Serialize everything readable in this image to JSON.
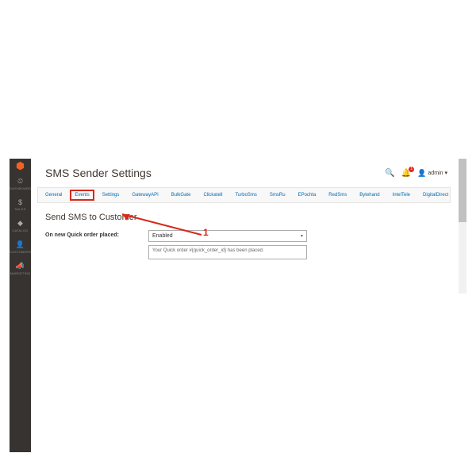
{
  "colors": {
    "accent": "#f26322",
    "link": "#006bb4",
    "annot": "#d62a1a",
    "sidebar": "#373330"
  },
  "sidebar": {
    "items": [
      {
        "icon": "⏲",
        "label": "DASHBOARD"
      },
      {
        "icon": "$",
        "label": "SALES"
      },
      {
        "icon": "◆",
        "label": "CATALOG"
      },
      {
        "icon": "👤",
        "label": "CUSTOMERS"
      },
      {
        "icon": "📣",
        "label": "MARKETING"
      }
    ]
  },
  "header": {
    "title": "SMS Sender Settings",
    "notif_count": "1",
    "user": "admin"
  },
  "tabs": [
    {
      "label": "General"
    },
    {
      "label": "Events",
      "active": true
    },
    {
      "label": "Settings"
    },
    {
      "label": "GatewayAPI"
    },
    {
      "label": "BulkGate"
    },
    {
      "label": "Clickatell"
    },
    {
      "label": "TurboSms"
    },
    {
      "label": "SmsRu"
    },
    {
      "label": "EPochta"
    },
    {
      "label": "RedSms"
    },
    {
      "label": "Bytehand"
    },
    {
      "label": "IntelTele"
    },
    {
      "label": "DigitalDirect"
    }
  ],
  "section": {
    "title": "Send SMS to Customer",
    "field_label": "On new Quick order placed:",
    "select_value": "Enabled",
    "textarea_value": "Your Quick order #{quick_order_id} has been placed."
  },
  "annotation": {
    "number": "1"
  }
}
